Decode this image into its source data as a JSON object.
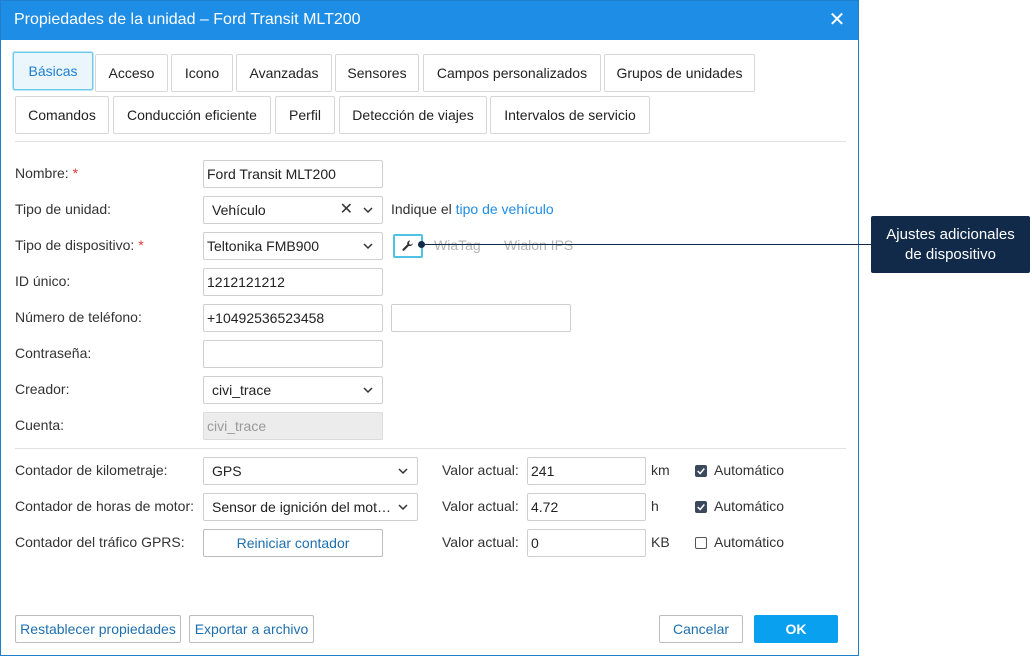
{
  "dialog": {
    "title": "Propiedades de la unidad – Ford Transit MLT200",
    "close_icon": "close-icon"
  },
  "tabs": [
    {
      "label": "Básicas",
      "active": true
    },
    {
      "label": "Acceso"
    },
    {
      "label": "Icono"
    },
    {
      "label": "Avanzadas"
    },
    {
      "label": "Sensores"
    },
    {
      "label": "Campos personalizados"
    },
    {
      "label": "Grupos de unidades"
    },
    {
      "label": "Comandos"
    },
    {
      "label": "Conducción eficiente"
    },
    {
      "label": "Perfil"
    },
    {
      "label": "Detección de viajes"
    },
    {
      "label": "Intervalos de servicio"
    }
  ],
  "form": {
    "name": {
      "label": "Nombre:",
      "required": "*",
      "value": "Ford Transit MLT200"
    },
    "unit_type": {
      "label": "Tipo de unidad:",
      "value": "Vehículo",
      "hint_prefix": "Indique el",
      "hint_link": "tipo de vehículo"
    },
    "device_type": {
      "label": "Tipo de dispositivo:",
      "required": "*",
      "value": "Teltonika FMB900",
      "link1": "WiaTag",
      "link2": "Wialon IPS"
    },
    "unique_id": {
      "label": "ID único:",
      "value": "1212121212"
    },
    "phone": {
      "label": "Número de teléfono:",
      "value": "+10492536523458",
      "value2": ""
    },
    "password": {
      "label": "Contraseña:",
      "value": ""
    },
    "creator": {
      "label": "Creador:",
      "value": "civi_trace"
    },
    "account": {
      "label": "Cuenta:",
      "value": "civi_trace"
    }
  },
  "counters": {
    "mileage": {
      "label": "Contador de kilometraje:",
      "value": "GPS",
      "current_label": "Valor actual:",
      "current_value": "241",
      "unit": "km",
      "auto_label": "Automático",
      "auto_checked": true
    },
    "engine_hours": {
      "label": "Contador de horas de motor:",
      "value": "Sensor de ignición del mot…",
      "current_label": "Valor actual:",
      "current_value": "4.72",
      "unit": "h",
      "auto_label": "Automático",
      "auto_checked": true
    },
    "gprs": {
      "label": "Contador del tráfico GPRS:",
      "reset_label": "Reiniciar contador",
      "current_label": "Valor actual:",
      "current_value": "0",
      "unit": "KB",
      "auto_label": "Automático",
      "auto_checked": false
    }
  },
  "footer": {
    "restore_label": "Restablecer propiedades",
    "export_label": "Exportar a archivo",
    "cancel_label": "Cancelar",
    "ok_label": "OK"
  },
  "callout": {
    "line1": "Ajustes adicionales",
    "line2": "de dispositivo"
  },
  "colors": {
    "titlebar": "#1e8de6",
    "accent": "#0aa0f0",
    "callout": "#112a4a",
    "required": "#e0383a"
  }
}
